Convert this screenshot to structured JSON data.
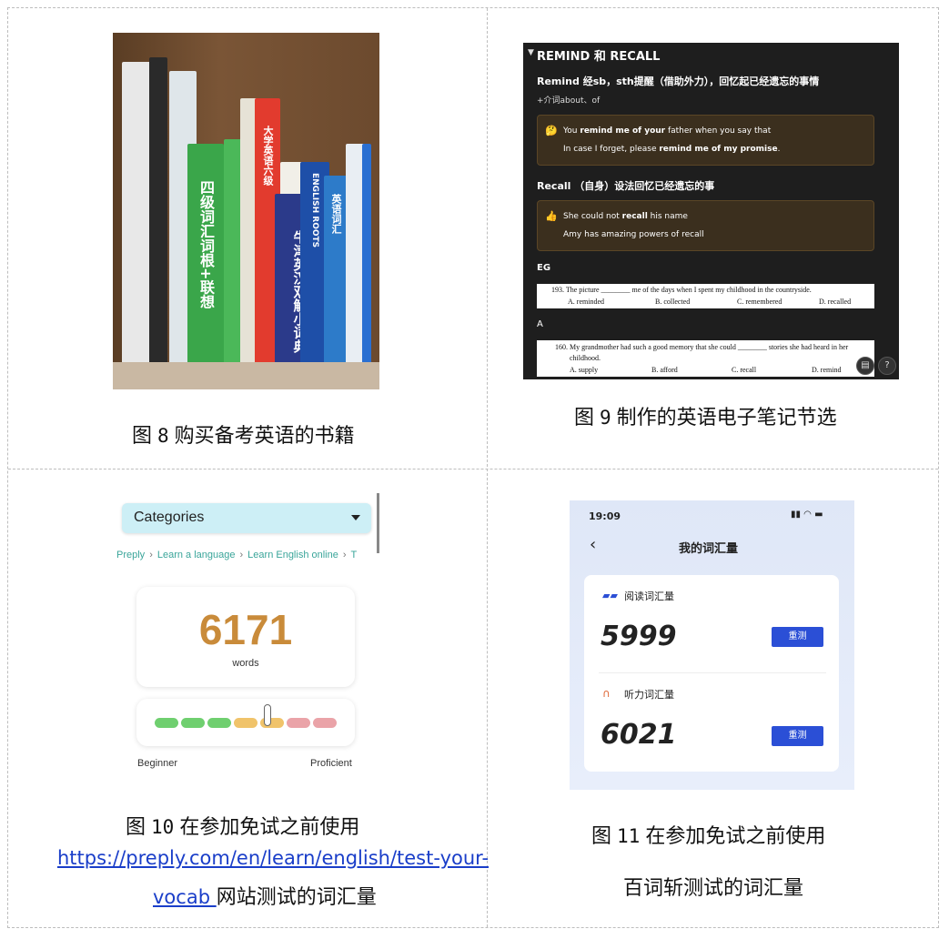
{
  "captions": {
    "fig8": {
      "prefix": "图",
      "num": "8",
      "text": "购买备考英语的书籍"
    },
    "fig9": {
      "prefix": "图",
      "num": "9",
      "text": "制作的英语电子笔记节选"
    },
    "fig10": {
      "prefix": "图",
      "num": "10",
      "text": "在参加免试之前使用",
      "link1": "https://preply.com/en/learn/english/test-your-",
      "link2": "vocab ",
      "tail": "网站测试的词汇量"
    },
    "fig11": {
      "prefix": "图",
      "num": "11",
      "text": "在参加免试之前使用",
      "line2": "百词斩测试的词汇量"
    }
  },
  "books": {
    "spine1": "四级词汇词根+联想",
    "spine2": "大学英语六级",
    "spine3": "牛津英汉双解小词典",
    "spine4": "ENGLISH ROOTS",
    "spine5": "英语词汇"
  },
  "notes": {
    "header": "REMIND 和 RECALL",
    "remind_title": "Remind 经sb，sth提醒（借助外力），回忆起已经遗忘的事情",
    "remind_sub": "+介词about、of",
    "remind_ex1_pre": "You ",
    "remind_ex1_bold": "remind me of your",
    "remind_ex1_post": " father when you say that",
    "remind_ex2_pre": "In case I forget, please ",
    "remind_ex2_bold": "remind me of my promise",
    "remind_ex2_post": ".",
    "recall_title": "Recall （自身）设法回忆已经遗忘的事",
    "recall_ex1_pre": "She could not ",
    "recall_ex1_bold": "recall",
    "recall_ex1_post": " his name",
    "recall_ex2": "Amy has amazing powers of recall",
    "eg": "EG",
    "q193": "193.  The picture ________ me of the days when I spent my childhood in the countryside.",
    "q193_a": "A. reminded",
    "q193_b": "B. collected",
    "q193_c": "C. remembered",
    "q193_d": "D. recalled",
    "answer1": "A",
    "q160": "160.  My grandmother had such a good memory that she could ________ stories she had heard in her",
    "q160_cont": "childhood.",
    "q160_a": "A. supply",
    "q160_b": "B. afford",
    "q160_c": "C. recall",
    "q160_d": "D. remind"
  },
  "preply": {
    "categories": "Categories",
    "crumbs": [
      "Preply",
      "Learn a language",
      "Learn English online",
      "T"
    ],
    "count": "6171",
    "unit": "words",
    "beginner": "Beginner",
    "proficient": "Proficient",
    "level_fraction": 0.62,
    "segment_colors": [
      "#6fcf6f",
      "#6fcf6f",
      "#6fcf6f",
      "#f0c36a",
      "#f0c36a",
      "#eaa3a8",
      "#eaa3a8"
    ]
  },
  "baicizhan": {
    "time": "19:09",
    "title": "我的词汇量",
    "reading_label": "阅读词汇量",
    "reading_value": "5999",
    "listening_label": "听力词汇量",
    "listening_value": "6021",
    "retest": "重测"
  }
}
